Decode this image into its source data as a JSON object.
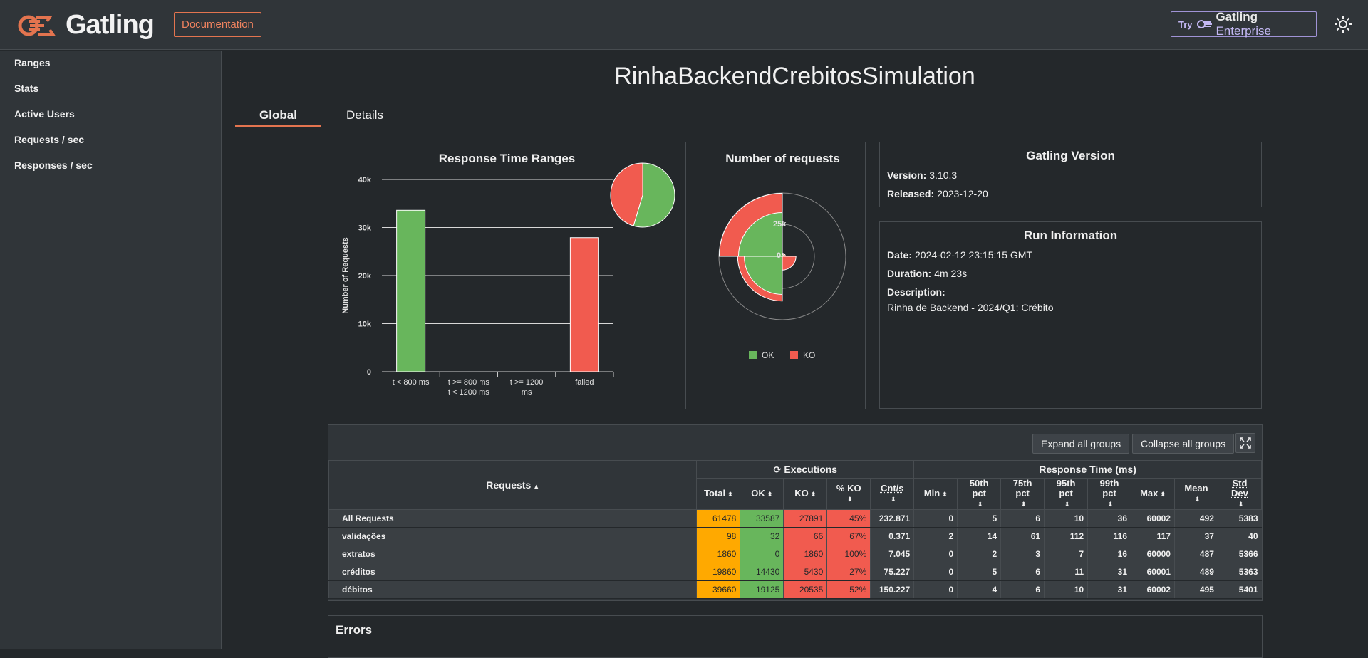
{
  "header": {
    "logo_text": "Gatling",
    "documentation_label": "Documentation",
    "enterprise_try": "Try",
    "enterprise_brand": "Gatling",
    "enterprise_suffix": "Enterprise",
    "theme_icon": "sun-icon",
    "accent_color": "#e3744f"
  },
  "sidebar": {
    "items": [
      {
        "label": "Ranges"
      },
      {
        "label": "Stats"
      },
      {
        "label": "Active Users"
      },
      {
        "label": "Requests / sec"
      },
      {
        "label": "Responses / sec"
      }
    ]
  },
  "main": {
    "title": "RinhaBackendCrebitosSimulation",
    "tabs": [
      {
        "label": "Global"
      },
      {
        "label": "Details"
      }
    ]
  },
  "response_time_ranges": {
    "title": "Response Time Ranges",
    "ylabel": "Number of Requests",
    "yticks": [
      "0",
      "10k",
      "20k",
      "30k",
      "40k"
    ],
    "categories": [
      "t < 800 ms",
      "t >= 800 ms t < 1200 ms",
      "t >= 1200 ms",
      "failed"
    ],
    "category_lines": [
      [
        "t < 800 ms"
      ],
      [
        "t >= 800 ms",
        "t < 1200 ms"
      ],
      [
        "t >= 1200",
        "ms"
      ],
      [
        "failed"
      ]
    ]
  },
  "number_of_requests": {
    "title": "Number of requests",
    "ticks": [
      "25k",
      "0"
    ],
    "legend": [
      {
        "label": "OK",
        "color": "#68b65c"
      },
      {
        "label": "KO",
        "color": "#f15b4f"
      }
    ]
  },
  "chart_data": [
    {
      "type": "bar",
      "title": "Response Time Ranges",
      "ylabel": "Number of Requests",
      "categories": [
        "t < 800 ms",
        "t >= 800 ms t < 1200 ms",
        "t >= 1200 ms",
        "failed"
      ],
      "values": [
        33587,
        0,
        0,
        27891
      ],
      "colors": [
        "#68b65c",
        "#ffa900",
        "#ffa900",
        "#f15b4f"
      ],
      "ylim": [
        0,
        40000
      ],
      "grid": true
    },
    {
      "type": "pie",
      "slices": [
        {
          "value": 33587,
          "color": "#68b65c"
        },
        {
          "value": 27891,
          "color": "#f15b4f"
        }
      ]
    },
    {
      "type": "polar-area",
      "title": "Number of requests",
      "series": [
        {
          "name": "OK",
          "values": [
            32,
            0,
            14430,
            19125
          ]
        },
        {
          "name": "KO",
          "values": [
            66,
            1860,
            5430,
            20535
          ]
        }
      ],
      "categories": [
        "validações",
        "extratos",
        "créditos",
        "débitos"
      ]
    }
  ],
  "gatling_version": {
    "title": "Gatling Version",
    "version_label": "Version:",
    "version": "3.10.3",
    "released_label": "Released:",
    "released": "2023-12-20"
  },
  "run_information": {
    "title": "Run Information",
    "date_label": "Date:",
    "date": "2024-02-12 23:15:15 GMT",
    "duration_label": "Duration:",
    "duration": "4m 23s",
    "description_label": "Description:",
    "description": "Rinha de Backend - 2024/Q1: Crébito"
  },
  "stats": {
    "expand_label": "Expand all groups",
    "collapse_label": "Collapse all groups",
    "requests_header": "Requests",
    "executions_header": "Executions",
    "response_time_header": "Response Time (ms)",
    "columns": [
      "Total",
      "OK",
      "KO",
      "% KO",
      "Cnt/s",
      "Min",
      "50th pct",
      "75th pct",
      "95th pct",
      "99th pct",
      "Max",
      "Mean",
      "Std Dev"
    ],
    "column_lines": [
      [
        "Total"
      ],
      [
        "OK"
      ],
      [
        "KO"
      ],
      [
        "% KO"
      ],
      [
        "Cnt/s"
      ],
      [
        "Min"
      ],
      [
        "50th",
        "pct"
      ],
      [
        "75th",
        "pct"
      ],
      [
        "95th",
        "pct"
      ],
      [
        "99th",
        "pct"
      ],
      [
        "Max"
      ],
      [
        "Mean"
      ],
      [
        "Std",
        "Dev"
      ]
    ],
    "rows": [
      {
        "name": "All Requests",
        "values": [
          "61478",
          "33587",
          "27891",
          "45%",
          "232.871",
          "0",
          "5",
          "6",
          "10",
          "36",
          "60002",
          "492",
          "5383"
        ]
      },
      {
        "name": "validações",
        "values": [
          "98",
          "32",
          "66",
          "67%",
          "0.371",
          "2",
          "14",
          "61",
          "112",
          "116",
          "117",
          "37",
          "40"
        ]
      },
      {
        "name": "extratos",
        "values": [
          "1860",
          "0",
          "1860",
          "100%",
          "7.045",
          "0",
          "2",
          "3",
          "7",
          "16",
          "60000",
          "487",
          "5366"
        ]
      },
      {
        "name": "créditos",
        "values": [
          "19860",
          "14430",
          "5430",
          "27%",
          "75.227",
          "0",
          "5",
          "6",
          "11",
          "31",
          "60001",
          "489",
          "5363"
        ]
      },
      {
        "name": "débitos",
        "values": [
          "39660",
          "19125",
          "20535",
          "52%",
          "150.227",
          "0",
          "4",
          "6",
          "10",
          "31",
          "60002",
          "495",
          "5401"
        ]
      }
    ]
  },
  "errors": {
    "title": "Errors"
  }
}
